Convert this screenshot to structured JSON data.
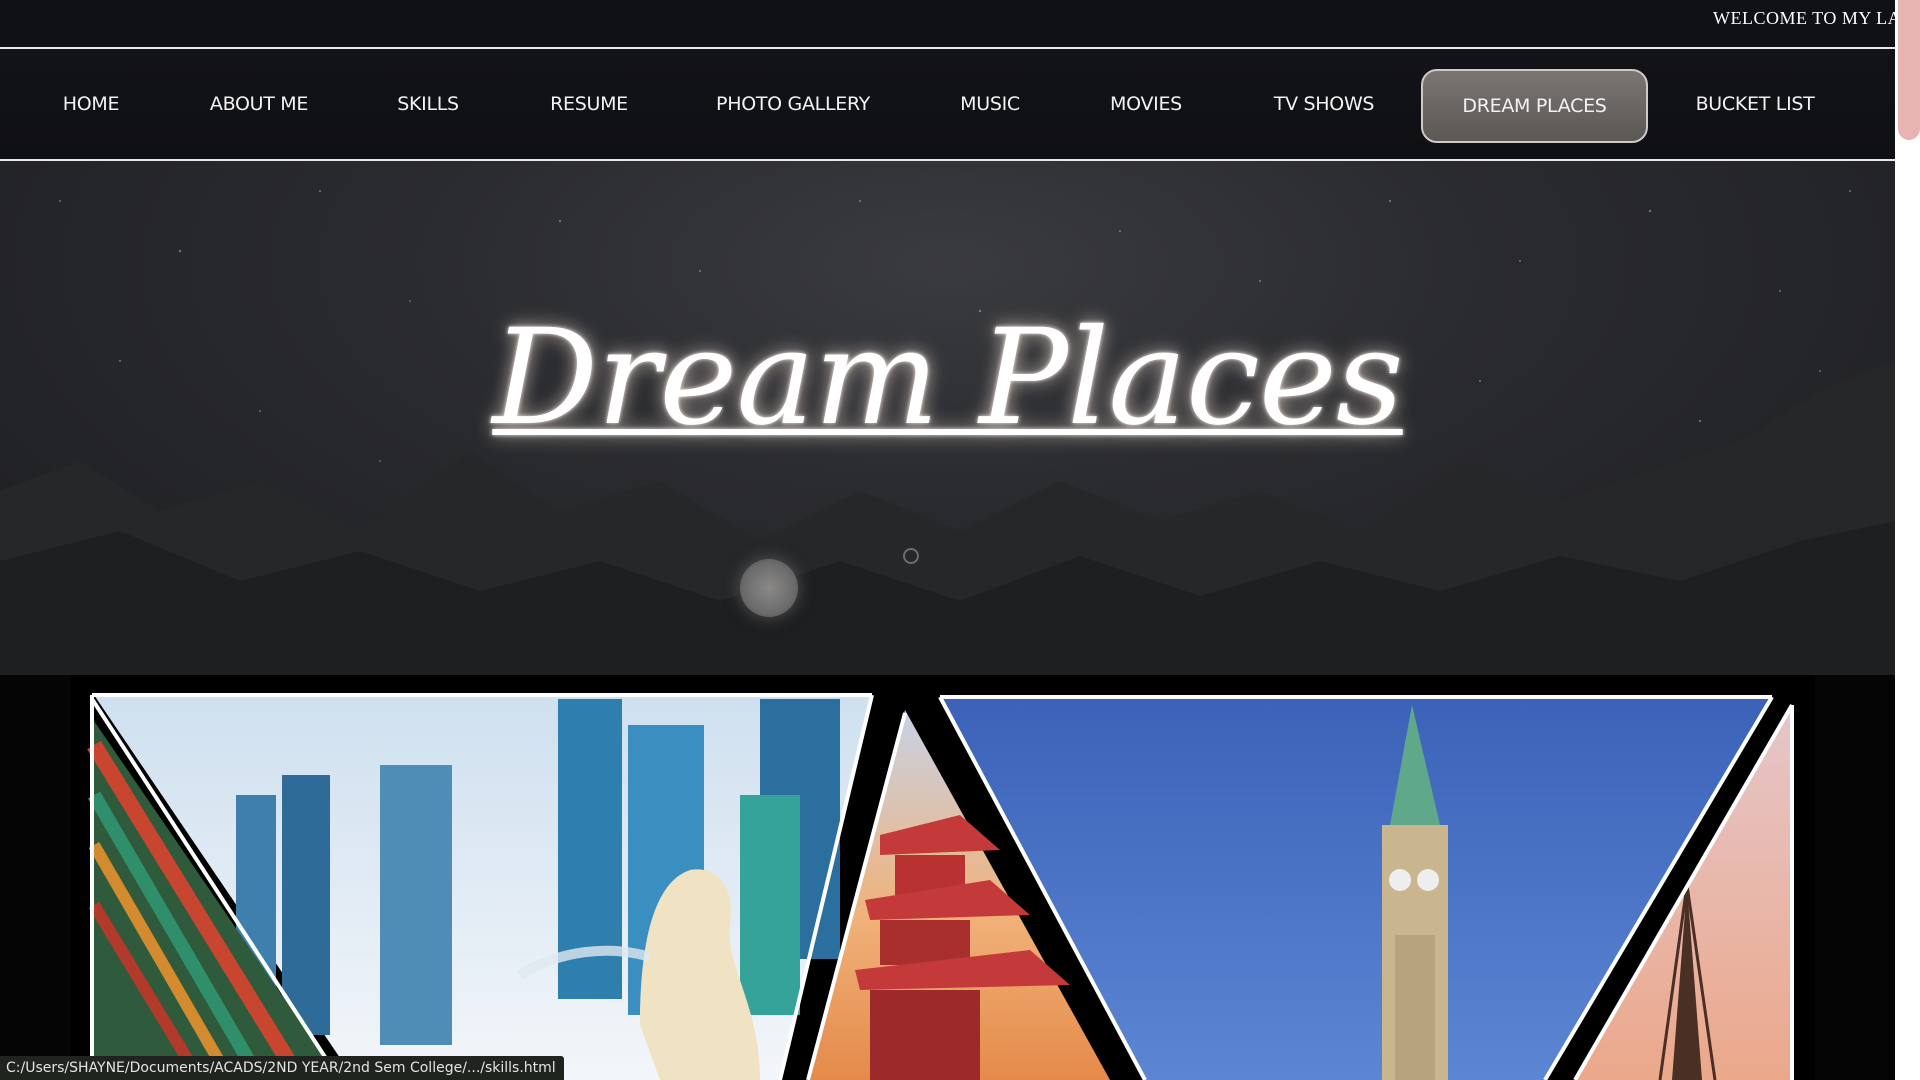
{
  "marquee": {
    "text": "WELCOME TO MY LA"
  },
  "nav": {
    "items": [
      {
        "label": "HOME"
      },
      {
        "label": "ABOUT ME"
      },
      {
        "label": "SKILLS"
      },
      {
        "label": "RESUME"
      },
      {
        "label": "PHOTO GALLERY"
      },
      {
        "label": "MUSIC"
      },
      {
        "label": "MOVIES"
      },
      {
        "label": "TV SHOWS"
      },
      {
        "label": "DREAM PLACES",
        "active": true
      },
      {
        "label": "BUCKET LIST"
      }
    ]
  },
  "hero": {
    "title": "Dream Places"
  },
  "gallery": {
    "images": [
      "korea-palace",
      "singapore-merlion",
      "japan-pagoda",
      "canada-peace-tower",
      "paris-eiffel-tower"
    ]
  },
  "status_bar": {
    "url": "C:/Users/SHAYNE/Documents/ACADS/2ND YEAR/2nd Sem College/.../skills.html"
  },
  "colors": {
    "background": "#0d0e12",
    "nav_active_bg": "#6b6764",
    "nav_border": "#e8e8e8",
    "scroll_thumb": "#e8b4b1"
  }
}
